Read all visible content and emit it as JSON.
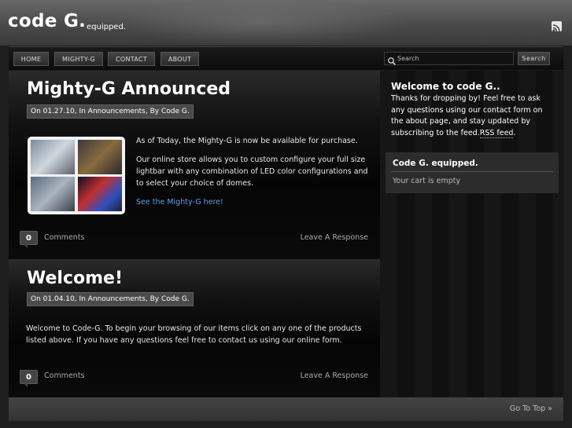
{
  "header": {
    "title": "code G.",
    "tagline": "equipped."
  },
  "nav": {
    "items": [
      "HOME",
      "MIGHTY-G",
      "CONTACT",
      "ABOUT"
    ],
    "search_placeholder": "Search",
    "search_button": "Search"
  },
  "posts": [
    {
      "title": "Mighty-G Announced",
      "meta": "On 01.27.10, In Announcements, By Code G.",
      "paragraphs": [
        "As of Today, the Mighty-G is now be available for purchase.",
        "Our online store allows you to custom configure your full size lightbar with any combination of LED color configurations and to select your choice of domes."
      ],
      "link": "See the Mighty-G here!",
      "comment_count": "0",
      "comments_label": "Comments",
      "response_label": "Leave A Response"
    },
    {
      "title": "Welcome!",
      "meta": "On 01.04.10, In Announcements, By Code G.",
      "paragraphs": [
        "Welcome to Code-G. To begin your browsing of our items click on any one of the products listed above.  If you have any questions feel free to contact us using our online form."
      ],
      "comment_count": "0",
      "comments_label": "Comments",
      "response_label": "Leave A Response"
    }
  ],
  "sidebar": {
    "welcome_title": "Welcome to code G..",
    "welcome_text": "Thanks for dropping by! Feel free to ask any questions using our contact form on the about page, and stay updated by subscribing to the feed.",
    "rss_link": "RSS feed",
    "welcome_end": ".",
    "cart_title": "Code G. equipped.",
    "cart_status": "Your cart is empty"
  },
  "footer": {
    "go_to_top": "Go To Top »"
  },
  "icons": {
    "rss": "rss-icon",
    "search": "search-icon"
  }
}
